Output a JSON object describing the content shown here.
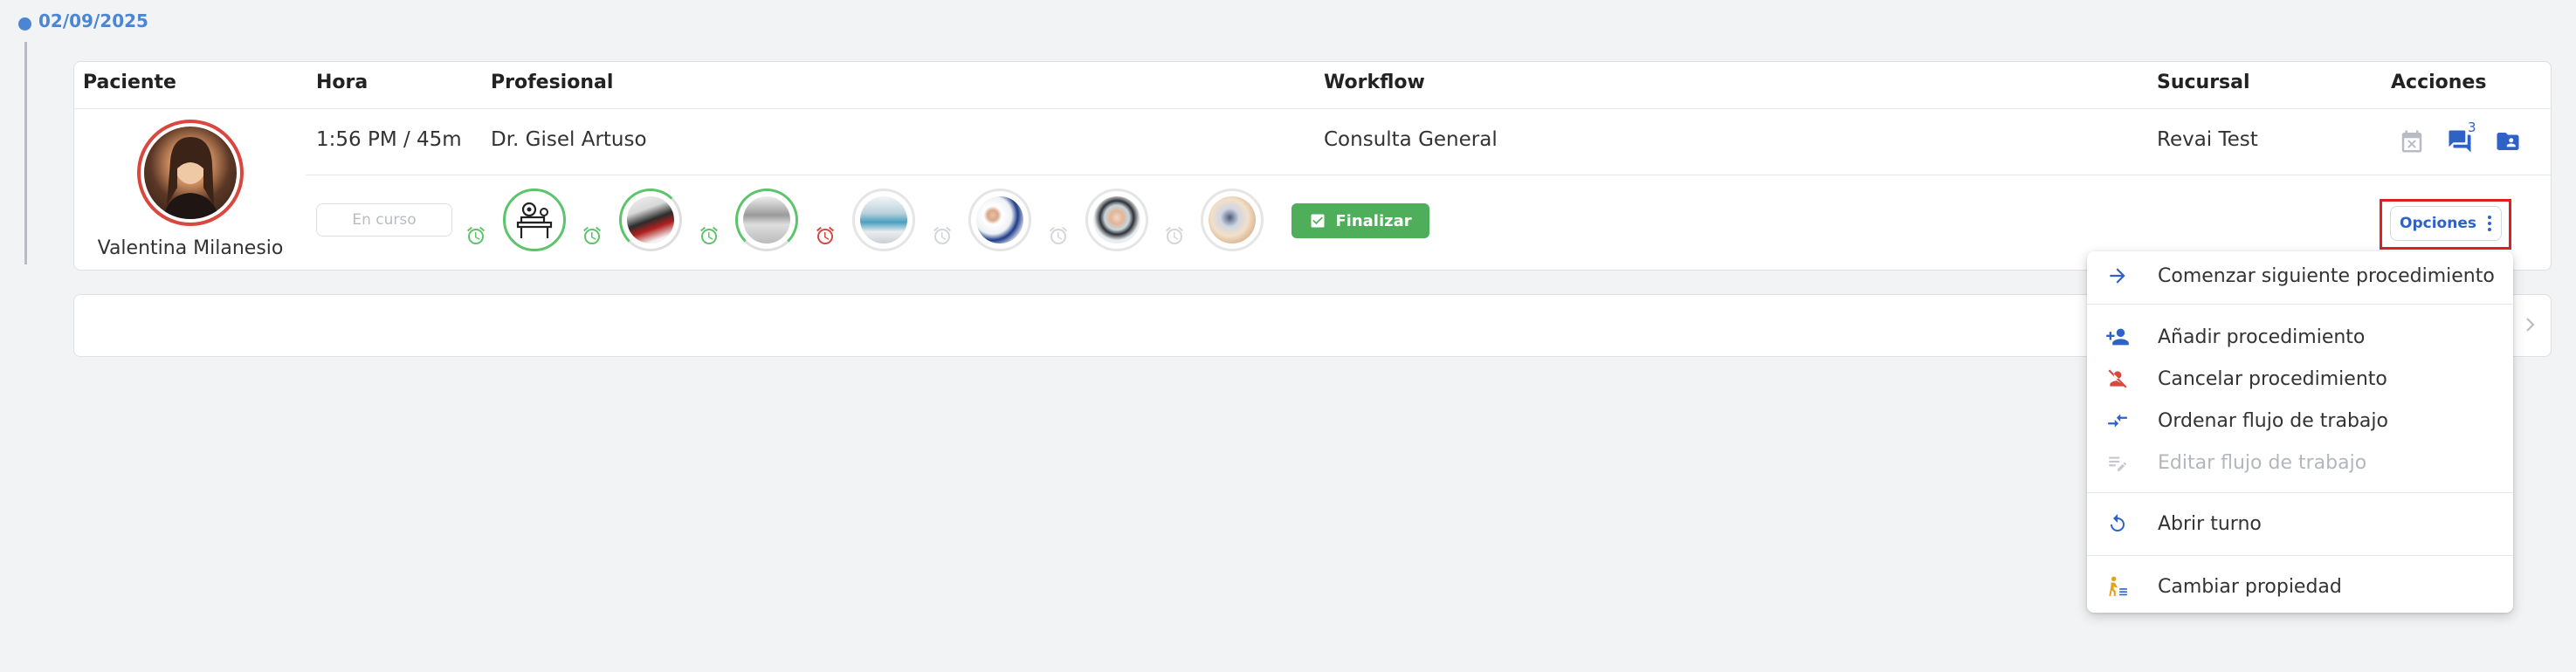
{
  "date": "02/09/2025",
  "headers": {
    "patient": "Paciente",
    "time": "Hora",
    "professional": "Profesional",
    "workflow": "Workflow",
    "branch": "Sucursal",
    "actions": "Acciones"
  },
  "row": {
    "patient_name": "Valentina Milanesio",
    "time": "1:56 PM / 45m",
    "professional": "Dr. Gisel Artuso",
    "workflow": "Consulta General",
    "branch": "Revai Test",
    "status": "En curso",
    "messages_badge": "3"
  },
  "finalize_label": "Finalizar",
  "options_label": "Opciones",
  "menu": {
    "items": [
      {
        "label": "Comenzar siguiente procedimiento",
        "icon": "arrow-right-icon"
      },
      {
        "label": "Añadir procedimiento",
        "icon": "person-add-icon"
      },
      {
        "label": "Cancelar procedimiento",
        "icon": "person-off-icon"
      },
      {
        "label": "Ordenar flujo de trabajo",
        "icon": "swap-icon"
      },
      {
        "label": "Editar flujo de trabajo",
        "icon": "edit-note-icon",
        "disabled": true
      },
      {
        "label": "Abrir turno",
        "icon": "restart-icon"
      },
      {
        "label": "Cambiar propiedad",
        "icon": "person-transfer-icon"
      }
    ]
  },
  "colors": {
    "accent": "#4a86d4",
    "finalize": "#4fae5a",
    "done": "#5cc46b",
    "alert": "#d9473f",
    "highlight": "#e02020"
  }
}
